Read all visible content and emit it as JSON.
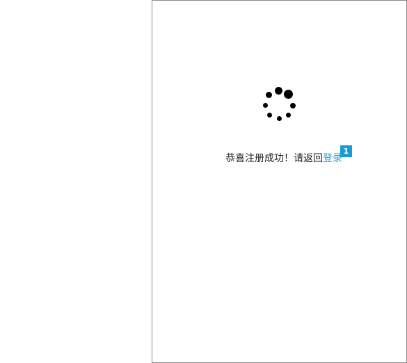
{
  "message": {
    "text": "恭喜注册成功！请返回",
    "link_label": "登录"
  },
  "badge": {
    "count": "1"
  },
  "colors": {
    "link": "#2aa0d6",
    "badge_bg": "#1a9bd7",
    "spinner": "#000000",
    "panel_border": "#8a8a8a"
  },
  "spinner": {
    "icon": "loading-spinner-icon"
  }
}
